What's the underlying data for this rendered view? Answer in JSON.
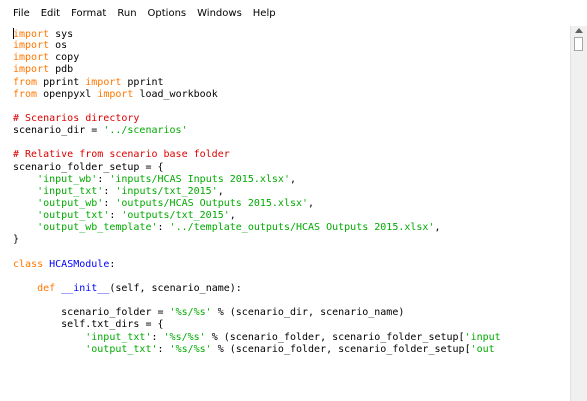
{
  "menu": [
    "File",
    "Edit",
    "Format",
    "Run",
    "Options",
    "Windows",
    "Help"
  ],
  "colors": {
    "keyword": "#ff7700",
    "string": "#00aa00",
    "comment": "#dd0000",
    "definition": "#0000ff",
    "text": "#000000",
    "background": "#ffffff"
  },
  "code_lines": [
    [
      [
        "kw",
        "import"
      ],
      [
        "t",
        " sys"
      ]
    ],
    [
      [
        "kw",
        "import"
      ],
      [
        "t",
        " os"
      ]
    ],
    [
      [
        "kw",
        "import"
      ],
      [
        "t",
        " copy"
      ]
    ],
    [
      [
        "kw",
        "import"
      ],
      [
        "t",
        " pdb"
      ]
    ],
    [
      [
        "kw",
        "from"
      ],
      [
        "t",
        " pprint "
      ],
      [
        "kw",
        "import"
      ],
      [
        "t",
        " pprint"
      ]
    ],
    [
      [
        "kw",
        "from"
      ],
      [
        "t",
        " openpyxl "
      ],
      [
        "kw",
        "import"
      ],
      [
        "t",
        " load_workbook"
      ]
    ],
    [],
    [
      [
        "com",
        "# Scenarios directory"
      ]
    ],
    [
      [
        "t",
        "scenario_dir = "
      ],
      [
        "str",
        "'../scenarios'"
      ]
    ],
    [],
    [
      [
        "com",
        "# Relative from scenario base folder"
      ]
    ],
    [
      [
        "t",
        "scenario_folder_setup = {"
      ]
    ],
    [
      [
        "t",
        "    "
      ],
      [
        "str",
        "'input_wb'"
      ],
      [
        "t",
        ": "
      ],
      [
        "str",
        "'inputs/HCAS Inputs 2015.xlsx'"
      ],
      [
        "t",
        ","
      ]
    ],
    [
      [
        "t",
        "    "
      ],
      [
        "str",
        "'input_txt'"
      ],
      [
        "t",
        ": "
      ],
      [
        "str",
        "'inputs/txt_2015'"
      ],
      [
        "t",
        ","
      ]
    ],
    [
      [
        "t",
        "    "
      ],
      [
        "str",
        "'output_wb'"
      ],
      [
        "t",
        ": "
      ],
      [
        "str",
        "'outputs/HCAS Outputs 2015.xlsx'"
      ],
      [
        "t",
        ","
      ]
    ],
    [
      [
        "t",
        "    "
      ],
      [
        "str",
        "'output_txt'"
      ],
      [
        "t",
        ": "
      ],
      [
        "str",
        "'outputs/txt_2015'"
      ],
      [
        "t",
        ","
      ]
    ],
    [
      [
        "t",
        "    "
      ],
      [
        "str",
        "'output_wb_template'"
      ],
      [
        "t",
        ": "
      ],
      [
        "str",
        "'../template_outputs/HCAS Outputs 2015.xlsx'"
      ],
      [
        "t",
        ","
      ]
    ],
    [
      [
        "t",
        "}"
      ]
    ],
    [],
    [
      [
        "kw",
        "class"
      ],
      [
        "t",
        " "
      ],
      [
        "def",
        "HCASModule"
      ],
      [
        "t",
        ":"
      ]
    ],
    [],
    [
      [
        "t",
        "    "
      ],
      [
        "kw",
        "def"
      ],
      [
        "t",
        " "
      ],
      [
        "def",
        "__init__"
      ],
      [
        "t",
        "(self, scenario_name):"
      ]
    ],
    [],
    [
      [
        "t",
        "        scenario_folder = "
      ],
      [
        "str",
        "'%s/%s'"
      ],
      [
        "t",
        " % (scenario_dir, scenario_name)"
      ]
    ],
    [
      [
        "t",
        "        self.txt_dirs = {"
      ]
    ],
    [
      [
        "t",
        "            "
      ],
      [
        "str",
        "'input_txt'"
      ],
      [
        "t",
        ": "
      ],
      [
        "str",
        "'%s/%s'"
      ],
      [
        "t",
        " % (scenario_folder, scenario_folder_setup["
      ],
      [
        "str",
        "'input"
      ]
    ],
    [
      [
        "t",
        "            "
      ],
      [
        "str",
        "'output_txt'"
      ],
      [
        "t",
        ": "
      ],
      [
        "str",
        "'%s/%s'"
      ],
      [
        "t",
        " % (scenario_folder, scenario_folder_setup["
      ],
      [
        "str",
        "'out"
      ]
    ]
  ]
}
